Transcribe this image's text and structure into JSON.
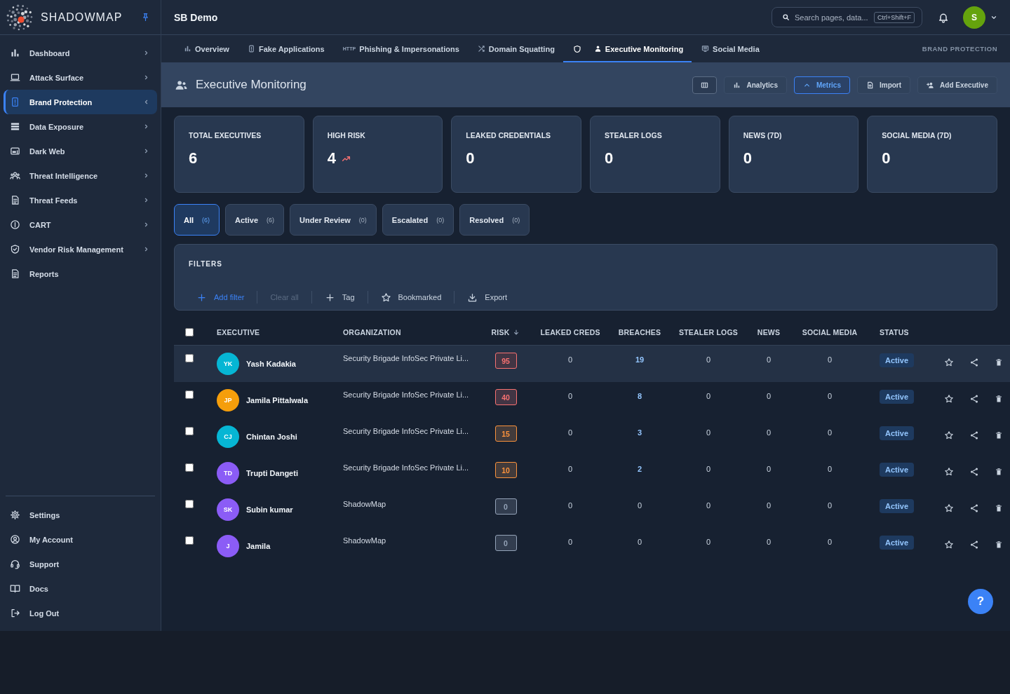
{
  "sidebar": {
    "brand": "SHADOWMAP",
    "pinned": true,
    "items": [
      {
        "label": "Dashboard",
        "selected": false,
        "expandable": true,
        "expanded": false
      },
      {
        "label": "Attack Surface",
        "selected": false,
        "expandable": true,
        "expanded": false
      },
      {
        "label": "Brand Protection",
        "selected": true,
        "expandable": true,
        "expanded": true
      },
      {
        "label": "Data Exposure",
        "selected": false,
        "expandable": true,
        "expanded": false
      },
      {
        "label": "Dark Web",
        "selected": false,
        "expandable": true,
        "expanded": false
      },
      {
        "label": "Threat Intelligence",
        "selected": false,
        "expandable": true,
        "expanded": false
      },
      {
        "label": "Threat Feeds",
        "selected": false,
        "expandable": true,
        "expanded": false
      },
      {
        "label": "CART",
        "selected": false,
        "expandable": true,
        "expanded": false
      },
      {
        "label": "Vendor Risk Management",
        "selected": false,
        "expandable": true,
        "expanded": false
      },
      {
        "label": "Reports",
        "selected": false,
        "expandable": false,
        "expanded": false
      }
    ],
    "footer_items": [
      {
        "label": "Settings"
      },
      {
        "label": "My Account"
      },
      {
        "label": "Support"
      },
      {
        "label": "Docs"
      },
      {
        "label": "Log Out"
      }
    ]
  },
  "topbar": {
    "workspace": "SB Demo",
    "search": {
      "placeholder": "Search pages, data...",
      "shortcut": "Ctrl+Shift+F"
    },
    "user_initial": "S"
  },
  "tabs": [
    {
      "label": "Overview",
      "selected": false
    },
    {
      "label": "Fake Applications",
      "selected": false
    },
    {
      "label": "Phishing & Impersonations",
      "icon_text": "HTTP",
      "selected": false
    },
    {
      "label": "Domain Squatting",
      "selected": false
    },
    {
      "label": "Executive Monitoring",
      "selected": true
    },
    {
      "label": "Social Media",
      "selected": false
    }
  ],
  "breadcrumb": "BRAND PROTECTION",
  "page_header": {
    "title": "Executive Monitoring",
    "buttons": [
      {
        "label": "Analytics",
        "selected": false
      },
      {
        "label": "Metrics",
        "selected": true
      },
      {
        "label": "Import",
        "selected": false
      },
      {
        "label": "Add Executive",
        "selected": false
      }
    ]
  },
  "stats": [
    {
      "label": "TOTAL EXECUTIVES",
      "value": "6",
      "trending_up": false
    },
    {
      "label": "HIGH RISK",
      "value": "4",
      "trending_up": true
    },
    {
      "label": "LEAKED CREDENTIALS",
      "value": "0",
      "trending_up": false
    },
    {
      "label": "STEALER LOGS",
      "value": "0",
      "trending_up": false
    },
    {
      "label": "NEWS (7D)",
      "value": "0",
      "trending_up": false
    },
    {
      "label": "SOCIAL MEDIA (7D)",
      "value": "0",
      "trending_up": false
    }
  ],
  "status_filters": [
    {
      "label": "All",
      "count": "(6)",
      "selected": true
    },
    {
      "label": "Active",
      "count": "(6)",
      "selected": false
    },
    {
      "label": "Under Review",
      "count": "(0)",
      "selected": false
    },
    {
      "label": "Escalated",
      "count": "(0)",
      "selected": false
    },
    {
      "label": "Resolved",
      "count": "(0)",
      "selected": false
    }
  ],
  "filters": {
    "title": "FILTERS",
    "actions": [
      {
        "label": "Add filter",
        "kind": "primary",
        "disabled": false
      },
      {
        "label": "Clear all",
        "kind": "plain",
        "disabled": true
      },
      {
        "label": "Tag",
        "kind": "plain",
        "disabled": false
      },
      {
        "label": "Bookmarked",
        "kind": "plain",
        "disabled": false
      },
      {
        "label": "Export",
        "kind": "plain",
        "disabled": false
      }
    ]
  },
  "table": {
    "select_all_checked": false,
    "columns": [
      {
        "label": "EXECUTIVE",
        "sorted": false
      },
      {
        "label": "ORGANIZATION",
        "sorted": false
      },
      {
        "label": "RISK",
        "sorted": true
      },
      {
        "label": "LEAKED CREDS",
        "sorted": false
      },
      {
        "label": "BREACHES",
        "sorted": false
      },
      {
        "label": "STEALER LOGS",
        "sorted": false
      },
      {
        "label": "NEWS",
        "sorted": false
      },
      {
        "label": "SOCIAL MEDIA",
        "sorted": false
      },
      {
        "label": "STATUS",
        "sorted": false
      }
    ],
    "rows": [
      {
        "checked": false,
        "highlighted": true,
        "initials": "YK",
        "color": "#06b6d4",
        "name": "Yash Kadakia",
        "organization": "Security Brigade InfoSec Private Li...",
        "risk": {
          "score": "95",
          "color": "#f87171"
        },
        "leaked_creds": "0",
        "breaches": "19",
        "breaches_linked": true,
        "stealer_logs": "0",
        "news": "0",
        "social_media": "0",
        "status": "Active",
        "bookmarked": false
      },
      {
        "checked": false,
        "highlighted": false,
        "initials": "JP",
        "color": "#f59e0b",
        "name": "Jamila Pittalwala",
        "organization": "Security Brigade InfoSec Private Li...",
        "risk": {
          "score": "40",
          "color": "#f87171"
        },
        "leaked_creds": "0",
        "breaches": "8",
        "breaches_linked": true,
        "stealer_logs": "0",
        "news": "0",
        "social_media": "0",
        "status": "Active",
        "bookmarked": false
      },
      {
        "checked": false,
        "highlighted": false,
        "initials": "CJ",
        "color": "#06b6d4",
        "name": "Chintan Joshi",
        "organization": "Security Brigade InfoSec Private Li...",
        "risk": {
          "score": "15",
          "color": "#fb923c"
        },
        "leaked_creds": "0",
        "breaches": "3",
        "breaches_linked": true,
        "stealer_logs": "0",
        "news": "0",
        "social_media": "0",
        "status": "Active",
        "bookmarked": false
      },
      {
        "checked": false,
        "highlighted": false,
        "initials": "TD",
        "color": "#8b5cf6",
        "name": "Trupti Dangeti",
        "organization": "Security Brigade InfoSec Private Li...",
        "risk": {
          "score": "10",
          "color": "#fb923c"
        },
        "leaked_creds": "0",
        "breaches": "2",
        "breaches_linked": true,
        "stealer_logs": "0",
        "news": "0",
        "social_media": "0",
        "status": "Active",
        "bookmarked": false
      },
      {
        "checked": false,
        "highlighted": false,
        "initials": "SK",
        "color": "#8b5cf6",
        "name": "Subin kumar",
        "organization": "ShadowMap",
        "risk": {
          "score": "0",
          "color": "#94a3b8"
        },
        "leaked_creds": "0",
        "breaches": "0",
        "breaches_linked": false,
        "stealer_logs": "0",
        "news": "0",
        "social_media": "0",
        "status": "Active",
        "bookmarked": false
      },
      {
        "checked": false,
        "highlighted": false,
        "initials": "J",
        "color": "#8b5cf6",
        "name": "Jamila",
        "organization": "ShadowMap",
        "risk": {
          "score": "0",
          "color": "#94a3b8"
        },
        "leaked_creds": "0",
        "breaches": "0",
        "breaches_linked": false,
        "stealer_logs": "0",
        "news": "0",
        "social_media": "0",
        "status": "Active",
        "bookmarked": false
      }
    ]
  },
  "help_button": "?"
}
